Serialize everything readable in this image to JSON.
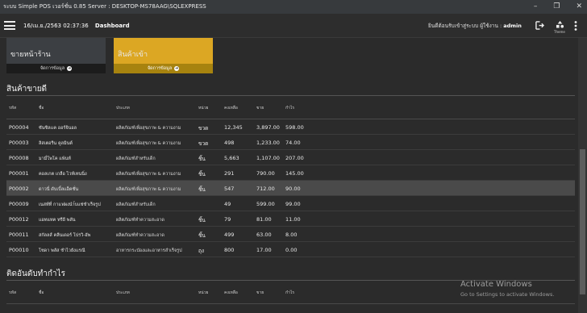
{
  "window": {
    "title": "ระบบ Simple POS เวอร์ชั่น 0.85 Server : DESKTOP-MS78AAG\\SQLEXPRESS",
    "minimize_icon": "minimize-icon",
    "maximize_icon": "maximize-icon",
    "close_icon": "close-icon"
  },
  "header": {
    "datetime": "16/เม.ย./2563 02:37:36",
    "page": "Dashboard",
    "welcome_prefix": "ยินดีต้อนรับเข้าสู่ระบบ ผู้ใช้งาน :",
    "user": "admin",
    "theme_label": "Theme"
  },
  "cards": [
    {
      "title": "ขายหน้าร้าน",
      "action": "จัดการข้อมูล",
      "color": "#3c3f43"
    },
    {
      "title": "สินค้าเข้า",
      "action": "จัดการข้อมูล",
      "color": "#dca723"
    }
  ],
  "best_sellers": {
    "title": "สินค้าขายดี",
    "columns": [
      "รหัส",
      "ชื่อ",
      "ประเภท",
      "หน่วย",
      "คงเหลือ",
      "ขาย",
      "กำไร"
    ],
    "rows": [
      [
        "P00004",
        "ซันซิลเเค ออร์จินอล",
        "ผลิตภัณฑ์เพื่อสุขภาพ & ความงาม",
        "ขวด",
        "12,345",
        "3,897.00",
        "598.00"
      ],
      [
        "P00003",
        "ลิสเตอรีน คูลมินต์",
        "ผลิตภัณฑ์เพื่อสุขภาพ & ความงาม",
        "ขวด",
        "498",
        "1,233.00",
        "74.00"
      ],
      [
        "P00008",
        "มามี่โพโค แพ้นท์",
        "ผลิตภัณฑ์สำหรับเด็ก",
        "ชิ้น",
        "5,663",
        "1,107.00",
        "207.00"
      ],
      [
        "P00001",
        "คอลเกต เกลือ ไวท์เทนนิ่ง",
        "ผลิตภัณฑ์เพื่อสุขภาพ & ความงาม",
        "ชิ้น",
        "291",
        "790.00",
        "145.00"
      ],
      [
        "P00002",
        "ดาวนี่ ดับเบิ้ลแอ็คชั่น",
        "ผลิตภัณฑ์เพื่อสุขภาพ & ความงาม",
        "ชิ้น",
        "547",
        "712.00",
        "90.00"
      ],
      [
        "P00009",
        "เนสท์ที่ กาแฟผงนำ้บแช่ชำเร็จรูป",
        "ผลิตภัณฑ์สำหรับเด็ก",
        "",
        "49",
        "599.00",
        "99.00"
      ],
      [
        "P00012",
        "แอทแทค ทรีอี พลัน",
        "ผลิตภัณฑ์ทำความสะอาด",
        "ชิ้น",
        "79",
        "81.00",
        "11.00"
      ],
      [
        "P00011",
        "สกัลลส์ คลีนเดอร์ โปรวิ-อัพ",
        "ผลิตภัณฑ์ทำความสะอาด",
        "ชิ้น",
        "499",
        "63.00",
        "8.00"
      ],
      [
        "P00010",
        "โซดา พลัส ชำไวยังเเรณี",
        "อาหารกระป๋องและอาหารสำเร็จรูป",
        "ถุง",
        "800",
        "17.00",
        "0.00"
      ]
    ],
    "highlighted_row": 4
  },
  "profit_ranking": {
    "title": "ติดอันดับทำกำไร",
    "columns": [
      "รหัส",
      "ชื่อ",
      "ประเภท",
      "หน่วย",
      "คงเหลือ",
      "ขาย",
      "กำไร"
    ]
  },
  "watermark": {
    "line1": "Activate Windows",
    "line2": "Go to Settings to activate Windows."
  }
}
